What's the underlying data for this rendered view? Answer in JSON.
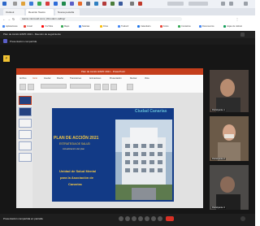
{
  "browser": {
    "tabs": [
      {
        "label": "Outlook",
        "active": false
      },
      {
        "label": "Reunión Teams",
        "active": true
      },
      {
        "label": "Nueva pestaña",
        "active": false
      }
    ],
    "url": "teams.microsoft.com/_#/modern-calling/"
  },
  "bookmarks": [
    "Aplicaciones",
    "Gmail",
    "YouTube",
    "Maps",
    "Noticias",
    "Drive",
    "Traducir",
    "Calendario",
    "Fotos",
    "Contactos",
    "Documentos",
    "Hojas de cálculo"
  ],
  "meeting": {
    "top_title": "Plan de Acción ESPF 2021 - Reunión de seguimiento",
    "sub_title": "Presentación compartida",
    "status_text": "Presentación compartida en pantalla"
  },
  "ppt": {
    "title": "Plan de Acción ESPF 2021 - PowerPoint",
    "ribbon_tabs": [
      "Archivo",
      "Inicio",
      "Insertar",
      "Diseño",
      "Transiciones",
      "Animaciones",
      "Presentación",
      "Revisar",
      "Vista"
    ]
  },
  "slide": {
    "logo": "Ciudad Canarias",
    "title": "PLAN DE ACCIÓN 2021",
    "line1": "ESTRATEGIA DE SALUD",
    "line2": "Actualización del plan",
    "body1": "Unidad de Salud Mental",
    "body2": "para la Asociación de",
    "body3": "Canarias"
  },
  "participants": [
    {
      "name": "Participante 1"
    },
    {
      "name": "Participante 2"
    },
    {
      "name": "Participante 3"
    }
  ],
  "colors": {
    "ppt_accent": "#c43e1c",
    "slide_bg": "#123a86",
    "slide_text": "#f6c945",
    "leave": "#d93025"
  }
}
